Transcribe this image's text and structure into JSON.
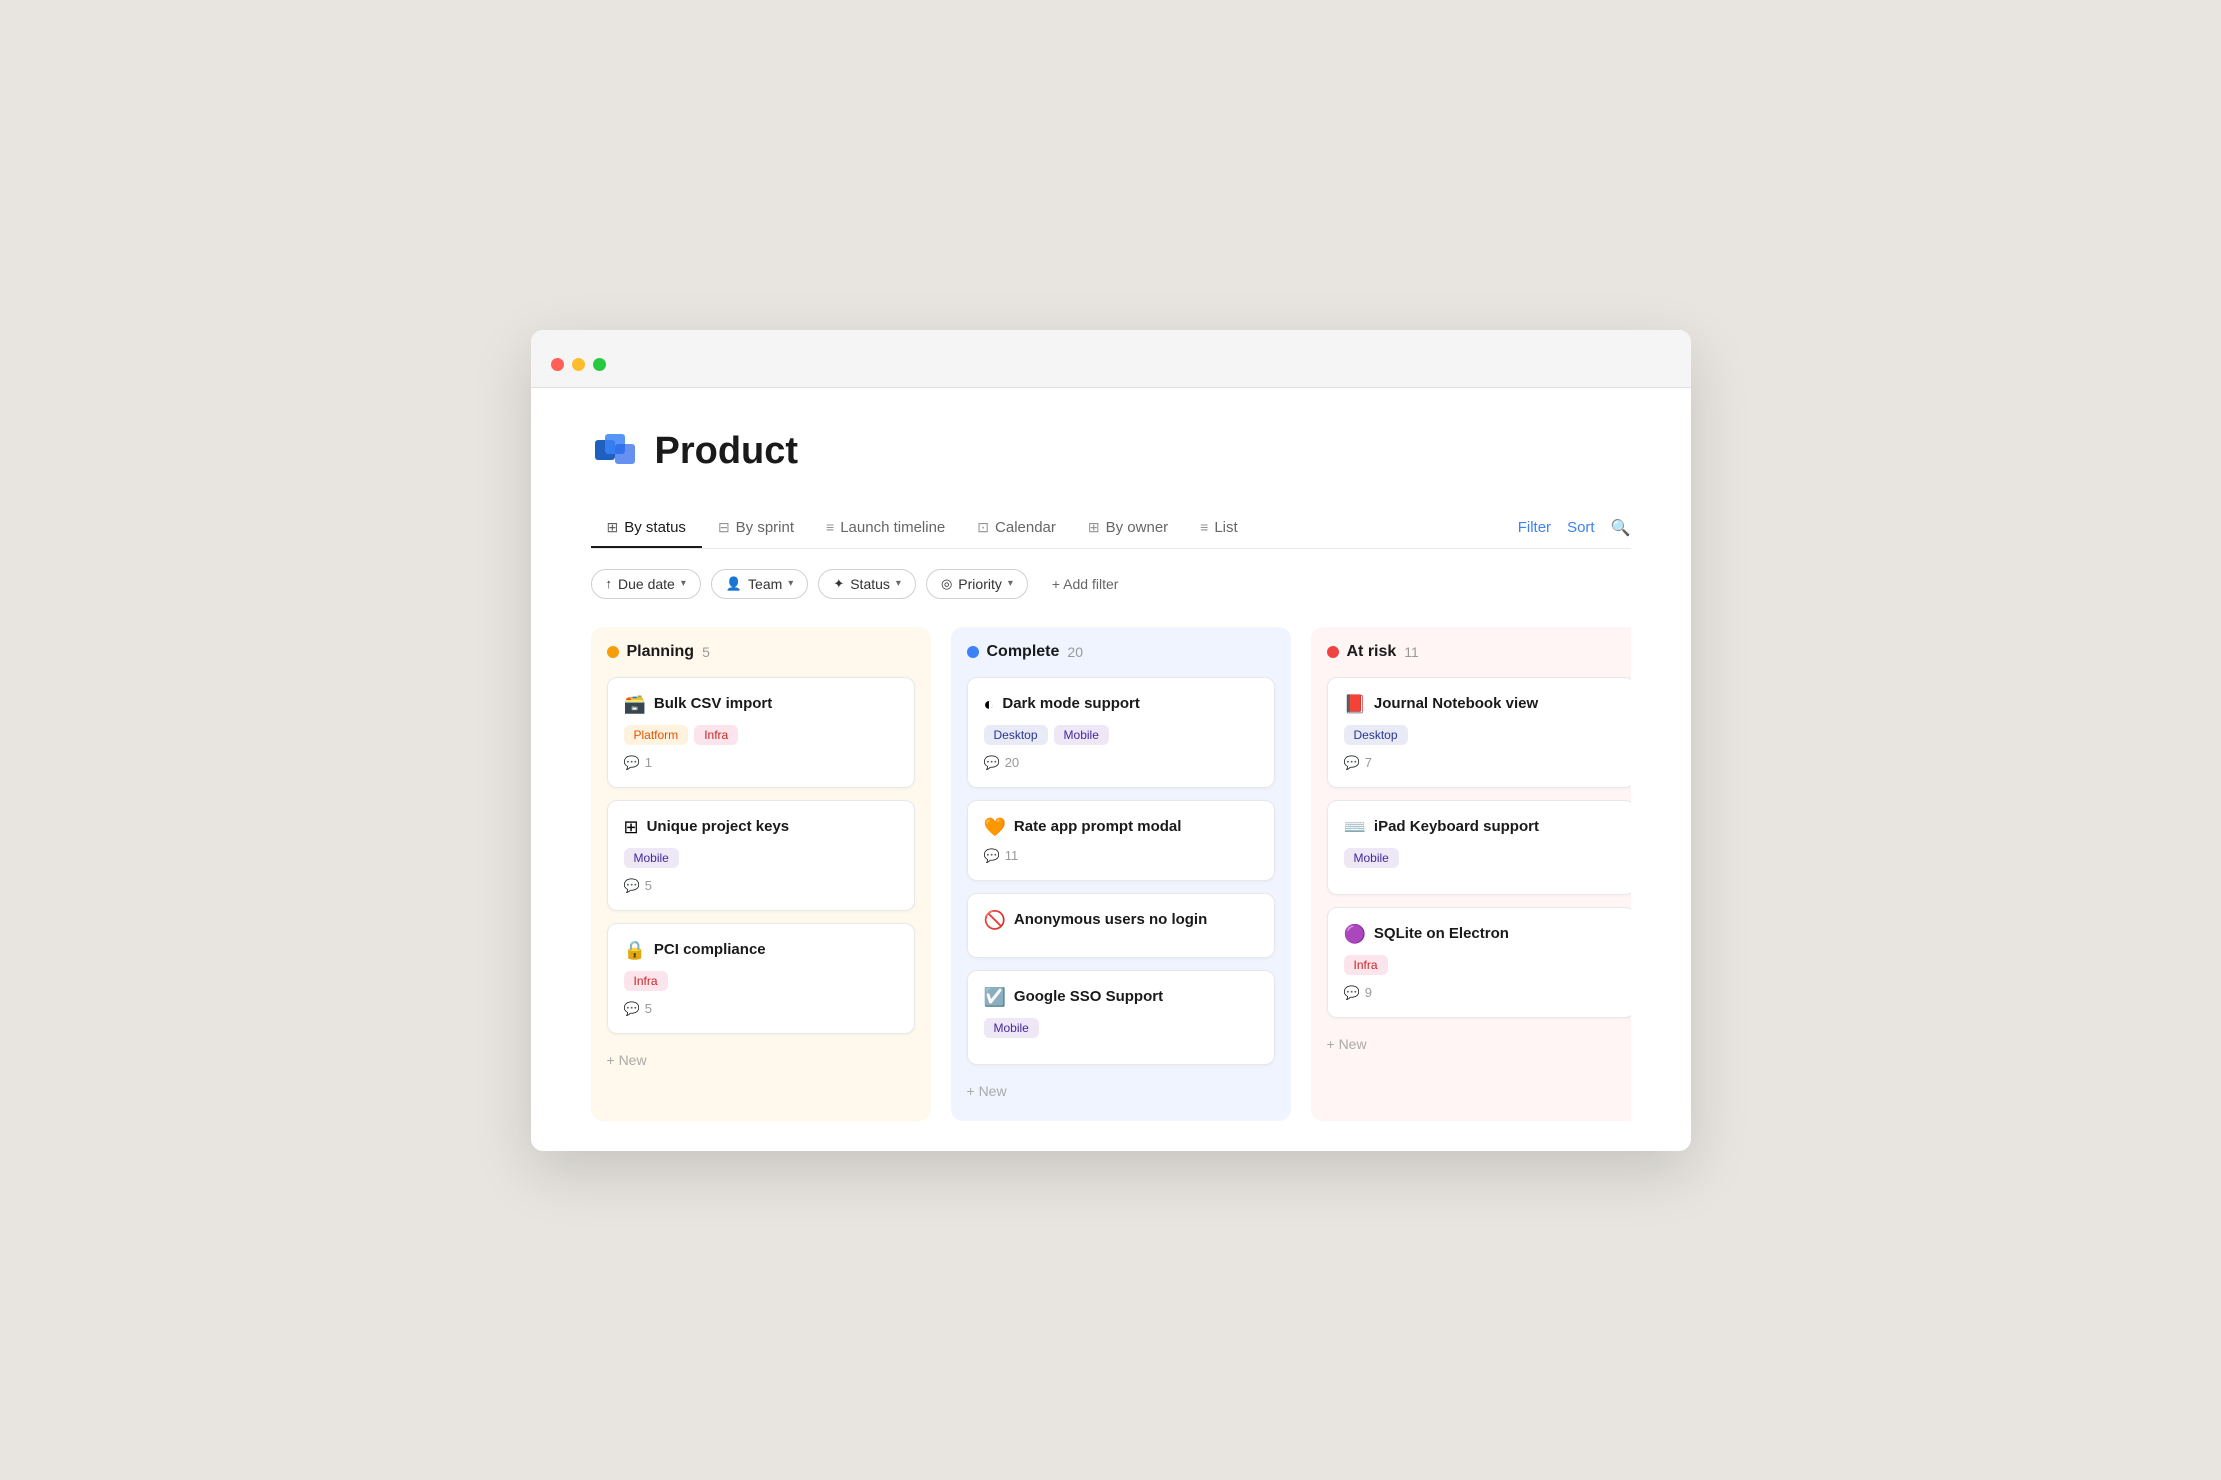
{
  "window": {
    "traffic_lights": [
      "red",
      "yellow",
      "green"
    ]
  },
  "header": {
    "icon_label": "product-cube-icon",
    "title": "Product"
  },
  "view_tabs": [
    {
      "id": "by-status",
      "label": "By status",
      "icon": "⊞",
      "active": true
    },
    {
      "id": "by-sprint",
      "label": "By sprint",
      "icon": "⊟",
      "active": false
    },
    {
      "id": "launch-timeline",
      "label": "Launch timeline",
      "icon": "≡",
      "active": false
    },
    {
      "id": "calendar",
      "label": "Calendar",
      "icon": "⊡",
      "active": false
    },
    {
      "id": "by-owner",
      "label": "By owner",
      "icon": "⊞",
      "active": false
    },
    {
      "id": "list",
      "label": "List",
      "icon": "≡",
      "active": false
    }
  ],
  "tab_actions": {
    "filter_label": "Filter",
    "sort_label": "Sort",
    "search_icon": "search"
  },
  "filters": [
    {
      "id": "due-date",
      "icon": "↑",
      "label": "Due date",
      "has_chevron": true
    },
    {
      "id": "team",
      "icon": "👤",
      "label": "Team",
      "has_chevron": true
    },
    {
      "id": "status",
      "icon": "✦",
      "label": "Status",
      "has_chevron": true
    },
    {
      "id": "priority",
      "icon": "◎",
      "label": "Priority",
      "has_chevron": true
    }
  ],
  "add_filter_label": "+ Add filter",
  "columns": [
    {
      "id": "planning",
      "title": "Planning",
      "count": 5,
      "dot_class": "dot-planning",
      "col_class": "col-planning",
      "cards": [
        {
          "id": "bulk-csv",
          "emoji": "🗃️",
          "title": "Bulk CSV import",
          "tags": [
            {
              "label": "Platform",
              "class": "tag-platform"
            },
            {
              "label": "Infra",
              "class": "tag-infra"
            }
          ],
          "comments": 1
        },
        {
          "id": "unique-project-keys",
          "emoji": "⊞",
          "title": "Unique project keys",
          "tags": [
            {
              "label": "Mobile",
              "class": "tag-mobile"
            }
          ],
          "comments": 5
        },
        {
          "id": "pci-compliance",
          "emoji": "🔒",
          "title": "PCI compliance",
          "tags": [
            {
              "label": "Infra",
              "class": "tag-infra"
            }
          ],
          "comments": 5
        }
      ],
      "new_label": "+ New"
    },
    {
      "id": "complete",
      "title": "Complete",
      "count": 20,
      "dot_class": "dot-complete",
      "col_class": "col-complete",
      "cards": [
        {
          "id": "dark-mode",
          "emoji": "◐",
          "title": "Dark mode support",
          "tags": [
            {
              "label": "Desktop",
              "class": "tag-desktop"
            },
            {
              "label": "Mobile",
              "class": "tag-mobile"
            }
          ],
          "comments": 20
        },
        {
          "id": "rate-app",
          "emoji": "🧡",
          "title": "Rate app prompt modal",
          "tags": [],
          "comments": 11
        },
        {
          "id": "anonymous-users",
          "emoji": "🚫",
          "title": "Anonymous users no login",
          "tags": [],
          "comments": null
        },
        {
          "id": "google-sso",
          "emoji": "☑️",
          "title": "Google SSO Support",
          "tags": [
            {
              "label": "Mobile",
              "class": "tag-mobile"
            }
          ],
          "comments": null
        }
      ],
      "new_label": "+ New"
    },
    {
      "id": "at-risk",
      "title": "At risk",
      "count": 11,
      "dot_class": "dot-at-risk",
      "col_class": "col-at-risk",
      "cards": [
        {
          "id": "journal-notebook",
          "emoji": "📕",
          "title": "Journal Notebook view",
          "tags": [
            {
              "label": "Desktop",
              "class": "tag-desktop"
            }
          ],
          "comments": 7
        },
        {
          "id": "ipad-keyboard",
          "emoji": "⌨️",
          "title": "iPad Keyboard support",
          "tags": [
            {
              "label": "Mobile",
              "class": "tag-mobile"
            }
          ],
          "comments": null
        },
        {
          "id": "sqlite-electron",
          "emoji": "🟣",
          "title": "SQLite on Electron",
          "tags": [
            {
              "label": "Infra",
              "class": "tag-infra"
            }
          ],
          "comments": 9
        }
      ],
      "new_label": "+ New"
    }
  ]
}
